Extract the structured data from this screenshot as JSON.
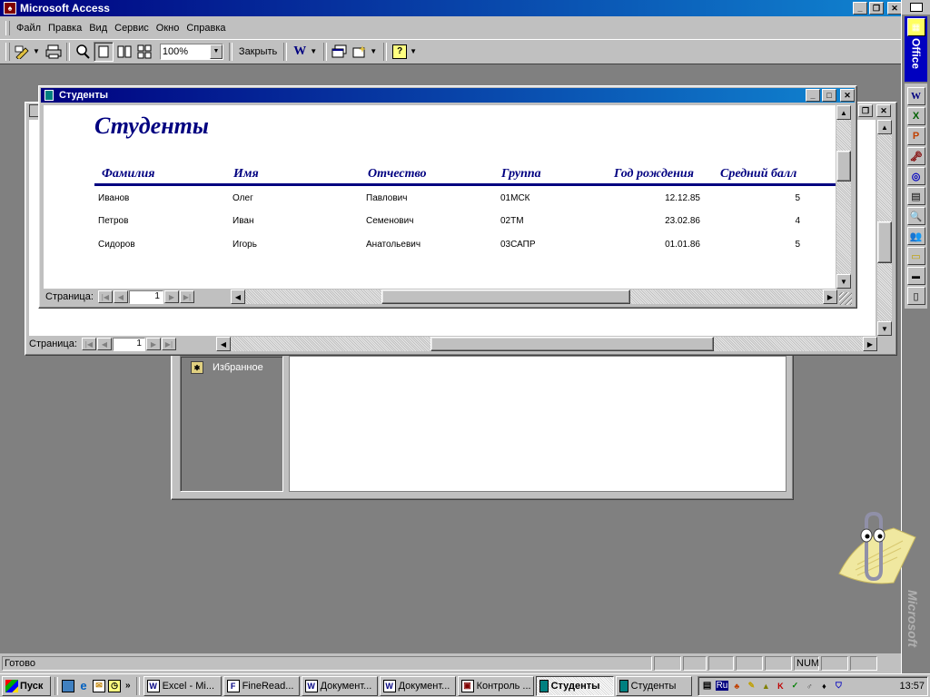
{
  "app": {
    "title": "Microsoft Access",
    "menu": [
      {
        "label": "Файл"
      },
      {
        "label": "Правка"
      },
      {
        "label": "Вид"
      },
      {
        "label": "Сервис"
      },
      {
        "label": "Окно"
      },
      {
        "label": "Справка"
      }
    ],
    "toolbar": {
      "zoom": "100%",
      "close_label": "Закрыть"
    },
    "status": {
      "text": "Готово",
      "num": "NUM"
    }
  },
  "report": {
    "window_title": "Студенты",
    "heading": "Студенты",
    "columns": [
      "Фамилия",
      "Имя",
      "Отчество",
      "Группа",
      "Год рождения",
      "Средний балл"
    ],
    "rows": [
      [
        "Иванов",
        "Олег",
        "Павлович",
        "01МСК",
        "12.12.85",
        "5"
      ],
      [
        "Петров",
        "Иван",
        "Семенович",
        "02ТМ",
        "23.02.86",
        "4"
      ],
      [
        "Сидоров",
        "Игорь",
        "Анатольевич",
        "03САПР",
        "01.01.86",
        "5"
      ]
    ],
    "page_label": "Страница:",
    "page_value": "1"
  },
  "back_window": {
    "page_label": "Страница:",
    "page_value": "1"
  },
  "db_window": {
    "favorites": "Избранное"
  },
  "office_bar": {
    "label": "Office",
    "watermark": "Microsoft"
  },
  "taskbar": {
    "start": "Пуск",
    "lang": "Ru",
    "clock": "13:57",
    "tasks": [
      {
        "label": "Excel - Mi...",
        "icon": "excel-icon"
      },
      {
        "label": "FineRead...",
        "icon": "finereader-icon"
      },
      {
        "label": "Документ...",
        "icon": "word-icon"
      },
      {
        "label": "Документ...",
        "icon": "word-icon"
      },
      {
        "label": "Контроль ...",
        "icon": "app-icon"
      },
      {
        "label": "Студенты",
        "icon": "report-icon",
        "active": true
      },
      {
        "label": "Студенты",
        "icon": "report-icon"
      }
    ]
  },
  "colors": {
    "titlebar": "#000080",
    "desktop": "#808080",
    "face": "#c0c0c0",
    "report_heading": "#000080"
  }
}
